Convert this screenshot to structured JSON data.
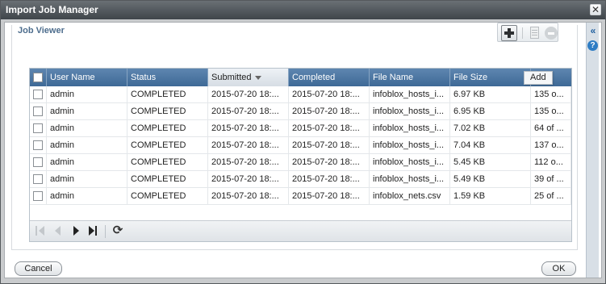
{
  "window": {
    "title": "Import Job Manager",
    "close_glyph": "✕"
  },
  "side_rail": {
    "collapse_glyph": "«",
    "help_glyph": "?"
  },
  "panel": {
    "heading": "Job Viewer"
  },
  "toolbar": {
    "add_icon": "plus-icon",
    "edit_icon": "document-icon",
    "remove_icon": "minus-circle-icon",
    "tooltip": "Add"
  },
  "grid": {
    "columns": [
      {
        "label": "User Name"
      },
      {
        "label": "Status"
      },
      {
        "label": "Submitted",
        "sorted": "desc"
      },
      {
        "label": "Completed"
      },
      {
        "label": "File Name"
      },
      {
        "label": "File Size"
      },
      {
        "label": ""
      }
    ],
    "rows": [
      {
        "user": "admin",
        "status": "COMPLETED",
        "submitted": "2015-07-20 18:...",
        "completed": "2015-07-20 18:...",
        "file_name": "infoblox_hosts_i...",
        "file_size": "6.97 KB",
        "extra": "135 o..."
      },
      {
        "user": "admin",
        "status": "COMPLETED",
        "submitted": "2015-07-20 18:...",
        "completed": "2015-07-20 18:...",
        "file_name": "infoblox_hosts_i...",
        "file_size": "6.95 KB",
        "extra": "135 o..."
      },
      {
        "user": "admin",
        "status": "COMPLETED",
        "submitted": "2015-07-20 18:...",
        "completed": "2015-07-20 18:...",
        "file_name": "infoblox_hosts_i...",
        "file_size": "7.02 KB",
        "extra": "64 of ..."
      },
      {
        "user": "admin",
        "status": "COMPLETED",
        "submitted": "2015-07-20 18:...",
        "completed": "2015-07-20 18:...",
        "file_name": "infoblox_hosts_i...",
        "file_size": "7.04 KB",
        "extra": "137 o..."
      },
      {
        "user": "admin",
        "status": "COMPLETED",
        "submitted": "2015-07-20 18:...",
        "completed": "2015-07-20 18:...",
        "file_name": "infoblox_hosts_i...",
        "file_size": "5.45 KB",
        "extra": "112 o..."
      },
      {
        "user": "admin",
        "status": "COMPLETED",
        "submitted": "2015-07-20 18:...",
        "completed": "2015-07-20 18:...",
        "file_name": "infoblox_hosts_i...",
        "file_size": "5.49 KB",
        "extra": "39 of ..."
      },
      {
        "user": "admin",
        "status": "COMPLETED",
        "submitted": "2015-07-20 18:...",
        "completed": "2015-07-20 18:...",
        "file_name": "infoblox_nets.csv",
        "file_size": "1.59 KB",
        "extra": "25 of ..."
      }
    ]
  },
  "pager": {
    "first_icon": "first-page-icon",
    "prev_icon": "prev-page-icon",
    "next_icon": "next-page-icon",
    "last_icon": "last-page-icon",
    "refresh_icon": "refresh-icon",
    "refresh_glyph": "⟳"
  },
  "footer": {
    "cancel_label": "Cancel",
    "ok_label": "OK"
  }
}
